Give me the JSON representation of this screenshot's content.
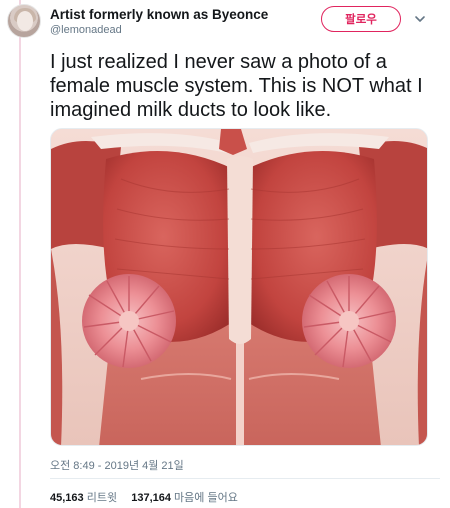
{
  "tweet": {
    "display_name": "Artist formerly known as Byeonce",
    "handle": "@lemonadead",
    "follow_label": "팔로우",
    "text": "I just realized I never saw a photo of a female muscle system. This is NOT what I imagined milk ducts to look like.",
    "timestamp": "오전 8:49 - 2019년 4월 21일",
    "retweet_count": "45,163",
    "retweet_label": "리트윗",
    "like_count": "137,164",
    "like_label": "마음에 들어요"
  },
  "colors": {
    "accent": "#e0245e",
    "secondary_text": "#657786",
    "primary_text": "#14171a",
    "thread_line": "#f3d6e2"
  },
  "icons": {
    "caret": "chevron-down-icon"
  }
}
